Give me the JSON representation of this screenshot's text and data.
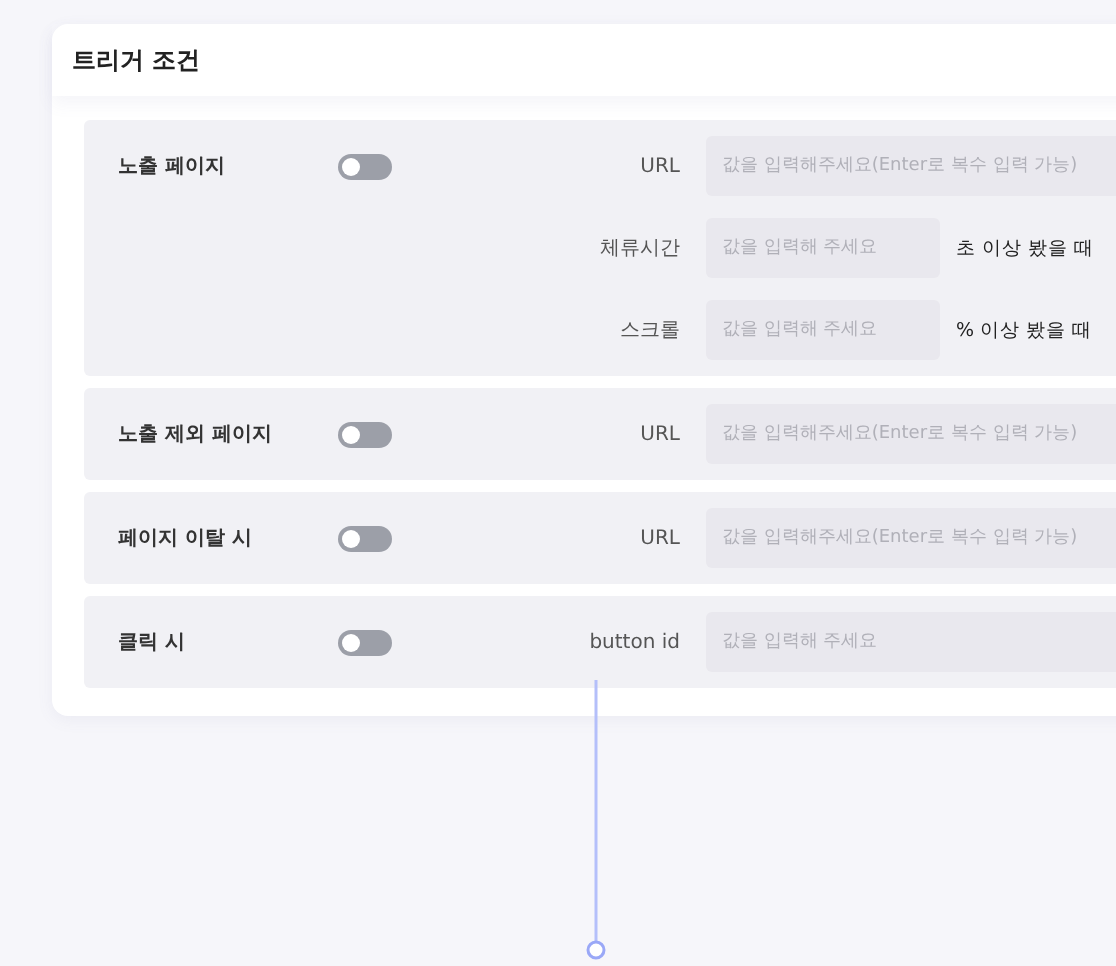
{
  "title": "트리거 조건",
  "sections": [
    {
      "title": "노출 페이지",
      "on": false,
      "fields": [
        {
          "kind": "wide",
          "label": "URL",
          "placeholder": "값을 입력해주세요(Enter로 복수 입력 가능)"
        },
        {
          "kind": "short",
          "label": "체류시간",
          "placeholder": "값을 입력해 주세요",
          "suffix": "초 이상 봤을 때"
        },
        {
          "kind": "short",
          "label": "스크롤",
          "placeholder": "값을 입력해 주세요",
          "suffix": "% 이상 봤을 때"
        }
      ]
    },
    {
      "title": "노출 제외 페이지",
      "on": false,
      "fields": [
        {
          "kind": "wide",
          "label": "URL",
          "placeholder": "값을 입력해주세요(Enter로 복수 입력 가능)"
        }
      ]
    },
    {
      "title": "페이지 이탈 시",
      "on": false,
      "fields": [
        {
          "kind": "wide",
          "label": "URL",
          "placeholder": "값을 입력해주세요(Enter로 복수 입력 가능)"
        }
      ]
    },
    {
      "title": "클릭 시",
      "on": false,
      "fields": [
        {
          "kind": "wide",
          "label": "button id",
          "placeholder": "값을 입력해 주세요"
        }
      ]
    }
  ]
}
